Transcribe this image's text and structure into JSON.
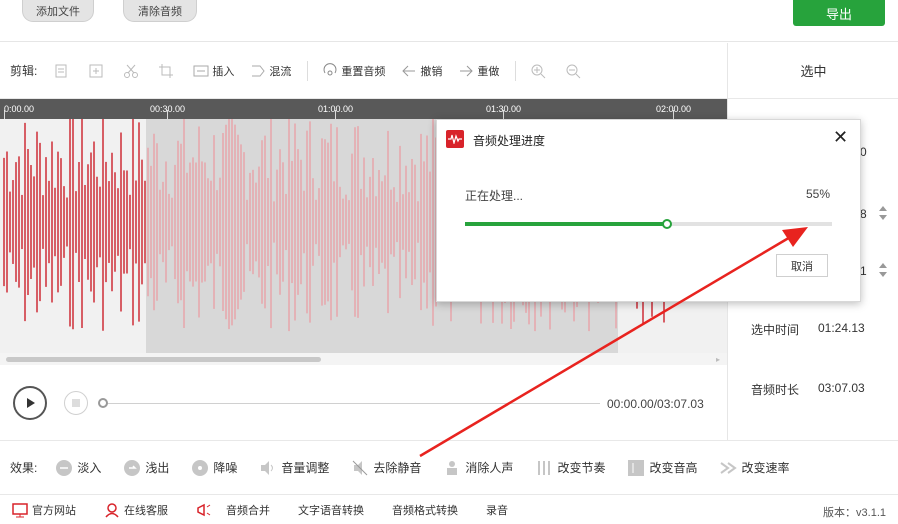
{
  "colors": {
    "accent": "#27a33c",
    "wave": "#cc1f2a",
    "wave_selected": "#e8a2a8",
    "arrow": "#e8231f"
  },
  "top": {
    "add_file": "添加文件",
    "clear_audio": "清除音频",
    "export": "导出"
  },
  "toolbar": {
    "label": "剪辑:",
    "insert": "插入",
    "mix": "混流",
    "reset_audio": "重置音频",
    "undo": "撤销",
    "redo": "重做"
  },
  "right_panel": {
    "title": "选中",
    "val1": "0",
    "val2": "8",
    "val3": "1",
    "selected_time_label": "选中时间",
    "selected_time": "01:24.13",
    "duration_label": "音频时长",
    "duration": "03:07.03"
  },
  "timeline": {
    "ticks": [
      "0:00.00",
      "00:30.00",
      "01:00.00",
      "01:30.00",
      "02:00.00"
    ]
  },
  "transport": {
    "time": "00:00.00/03:07.03"
  },
  "effects": {
    "label": "效果:",
    "items": [
      "淡入",
      "浅出",
      "降噪",
      "音量调整",
      "去除静音",
      "消除人声",
      "改变节奏",
      "改变音高",
      "改变速率"
    ]
  },
  "bottom": {
    "website": "官方网站",
    "support": "在线客服",
    "merge": "音频合并",
    "tts": "文字语音转换",
    "format": "音频格式转换",
    "record": "录音",
    "version": "版本：v3.1.1"
  },
  "dialog": {
    "title": "音频处理进度",
    "status": "正在处理...",
    "percent_label": "55%",
    "progress": 0.55,
    "cancel": "取消"
  }
}
